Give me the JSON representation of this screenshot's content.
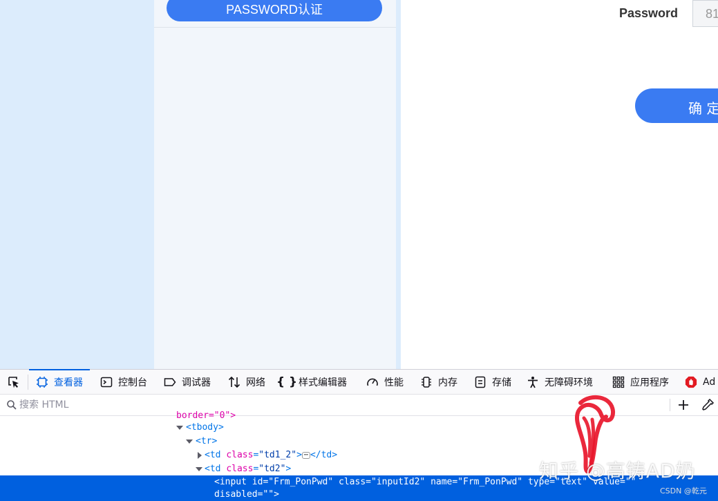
{
  "page": {
    "auth_button": "PASSWORD认证",
    "password_label": "Password",
    "password_value": "81",
    "confirm_button": "确 定"
  },
  "devtools": {
    "tabs": [
      {
        "label": "查看器",
        "icon": "inspector-icon",
        "active": true
      },
      {
        "label": "控制台",
        "icon": "console-icon"
      },
      {
        "label": "调试器",
        "icon": "debugger-icon"
      },
      {
        "label": "网络",
        "icon": "network-icon"
      },
      {
        "label": "样式编辑器",
        "icon": "style-editor-icon"
      },
      {
        "label": "性能",
        "icon": "performance-icon"
      },
      {
        "label": "内存",
        "icon": "memory-icon"
      },
      {
        "label": "存储",
        "icon": "storage-icon"
      },
      {
        "label": "无障碍环境",
        "icon": "accessibility-icon"
      },
      {
        "label": "应用程序",
        "icon": "application-icon"
      },
      {
        "label": "Ad",
        "icon": "adblock-icon"
      }
    ],
    "search_placeholder": "搜索 HTML",
    "tree": {
      "l0": "border=\"0\">",
      "l1": "<tbody>",
      "l2": "<tr>",
      "l3_open": "<td ",
      "l3_attr": "class",
      "l3_val": "\"td1_2\"",
      "l3_close": ">",
      "l3_end": "</td>",
      "l3_ellipsis": "⋯",
      "l4_open": "<td ",
      "l4_attr": "class",
      "l4_val": "\"td2\"",
      "l4_close": ">",
      "selected_line1": "<input id=\"Frm_PonPwd\" class=\"inputId2\" name=\"Frm_PonPwd\" type=\"text\" value=\"\"",
      "selected_line2": "disabled=\"\">"
    }
  },
  "overlay": {
    "watermark": "知乎 @高铸AD奶",
    "csdn": "CSDN @乾元"
  },
  "colors": {
    "accent": "#3a7bf2",
    "devtools_accent": "#0060df",
    "scribble": "#e8162b"
  }
}
